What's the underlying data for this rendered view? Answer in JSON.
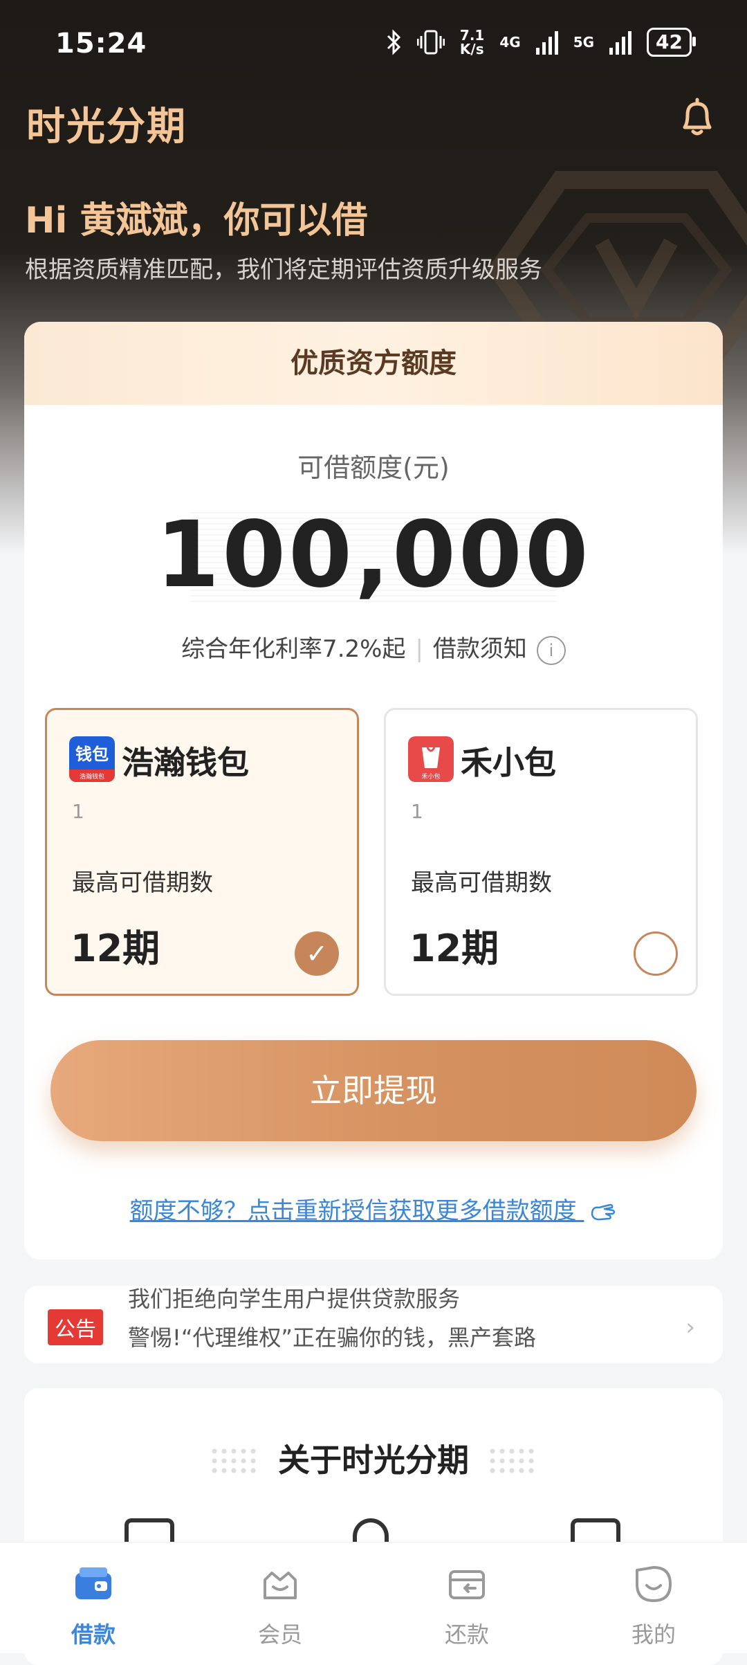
{
  "status_bar": {
    "time": "15:24",
    "speed": "7.1\nK/s",
    "net1": "4G",
    "net2": "5G",
    "battery": "42"
  },
  "header": {
    "app_title": "时光分期"
  },
  "greeting": {
    "title": "Hi 黄斌斌，你可以借",
    "subtitle": "根据资质精准匹配，我们将定期评估资质升级服务"
  },
  "card": {
    "head": "优质资方额度",
    "limit_label": "可借额度(元)",
    "limit_amount": "100,000",
    "rate": "综合年化利率7.2%起",
    "rate_sep": "|",
    "notice_link": "借款须知",
    "info_icon": "i"
  },
  "options": [
    {
      "name": "浩瀚钱包",
      "sub": "1",
      "label": "最高可借期数",
      "period": "12期",
      "logo_text": "钱包",
      "logo_caption": "浩瀚钱包",
      "selected": true
    },
    {
      "name": "禾小包",
      "sub": "1",
      "label": "最高可借期数",
      "period": "12期",
      "logo_text": "",
      "logo_caption": "禾小包",
      "selected": false
    }
  ],
  "cta": {
    "label": "立即提现"
  },
  "more_link": {
    "label": "额度不够？点击重新授信获取更多借款额度"
  },
  "announcement": {
    "tag": "公告",
    "line1": "我们拒绝向学生用户提供贷款服务",
    "line2": "警惕!“代理维权”正在骗你的钱，黑产套路",
    "chevron": "›"
  },
  "about": {
    "title": "关于时光分期"
  },
  "tabs": [
    {
      "label": "借款",
      "icon": "wallet-icon",
      "active": true
    },
    {
      "label": "会员",
      "icon": "crown-bag-icon",
      "active": false
    },
    {
      "label": "还款",
      "icon": "card-icon",
      "active": false
    },
    {
      "label": "我的",
      "icon": "smile-icon",
      "active": false
    }
  ],
  "colors": {
    "accent": "#c7865a",
    "gold_text": "#f4c597",
    "link": "#3a86d8",
    "active_tab": "#3a86d8"
  }
}
